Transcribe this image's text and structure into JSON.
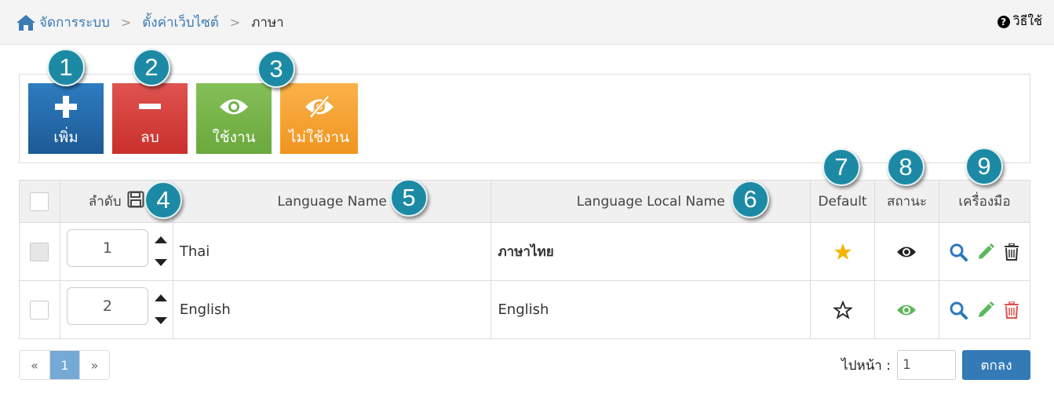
{
  "breadcrumb": {
    "items": [
      "จัดการระบบ",
      "ตั้งค่าเว็บไซต์"
    ],
    "current": "ภาษา",
    "separator": ">"
  },
  "help": {
    "icon": "question-circle-icon",
    "label": "วิธีใช้"
  },
  "toolbar": {
    "add_label": "เพิ่ม",
    "delete_label": "ลบ",
    "enable_label": "ใช้งาน",
    "disable_label": "ไม่ใช้งาน"
  },
  "table": {
    "columns": {
      "order": "ลำดับ",
      "name": "Language Name",
      "local_name": "Language Local Name",
      "default": "Default",
      "status": "สถานะ",
      "tools": "เครื่องมือ"
    },
    "rows": [
      {
        "order": "1",
        "name": "Thai",
        "local_name": "ภาษาไทย",
        "is_default": true,
        "status": "active",
        "checkbox": "disabled"
      },
      {
        "order": "2",
        "name": "English",
        "local_name": "English",
        "is_default": false,
        "status": "active",
        "checkbox": "unchecked"
      }
    ]
  },
  "pagination": {
    "prev": "«",
    "current": "1",
    "next": "»"
  },
  "goto": {
    "label": "ไปหน้า :",
    "value": "1",
    "button": "ตกลง"
  },
  "annotations": [
    "1",
    "2",
    "3",
    "4",
    "5",
    "6",
    "7",
    "8",
    "9"
  ],
  "colors": {
    "link": "#3a7bb4",
    "add": "#1f5f9c",
    "delete": "#d2322d",
    "enable": "#74b14a",
    "disable": "#f7a434",
    "badge": "#1c8aa4",
    "star_active": "#f5b400",
    "eye_green": "#5cb85c",
    "search_icon": "#2b78c0",
    "edit_icon": "#5cb85c",
    "trash_red": "#d9534f"
  }
}
